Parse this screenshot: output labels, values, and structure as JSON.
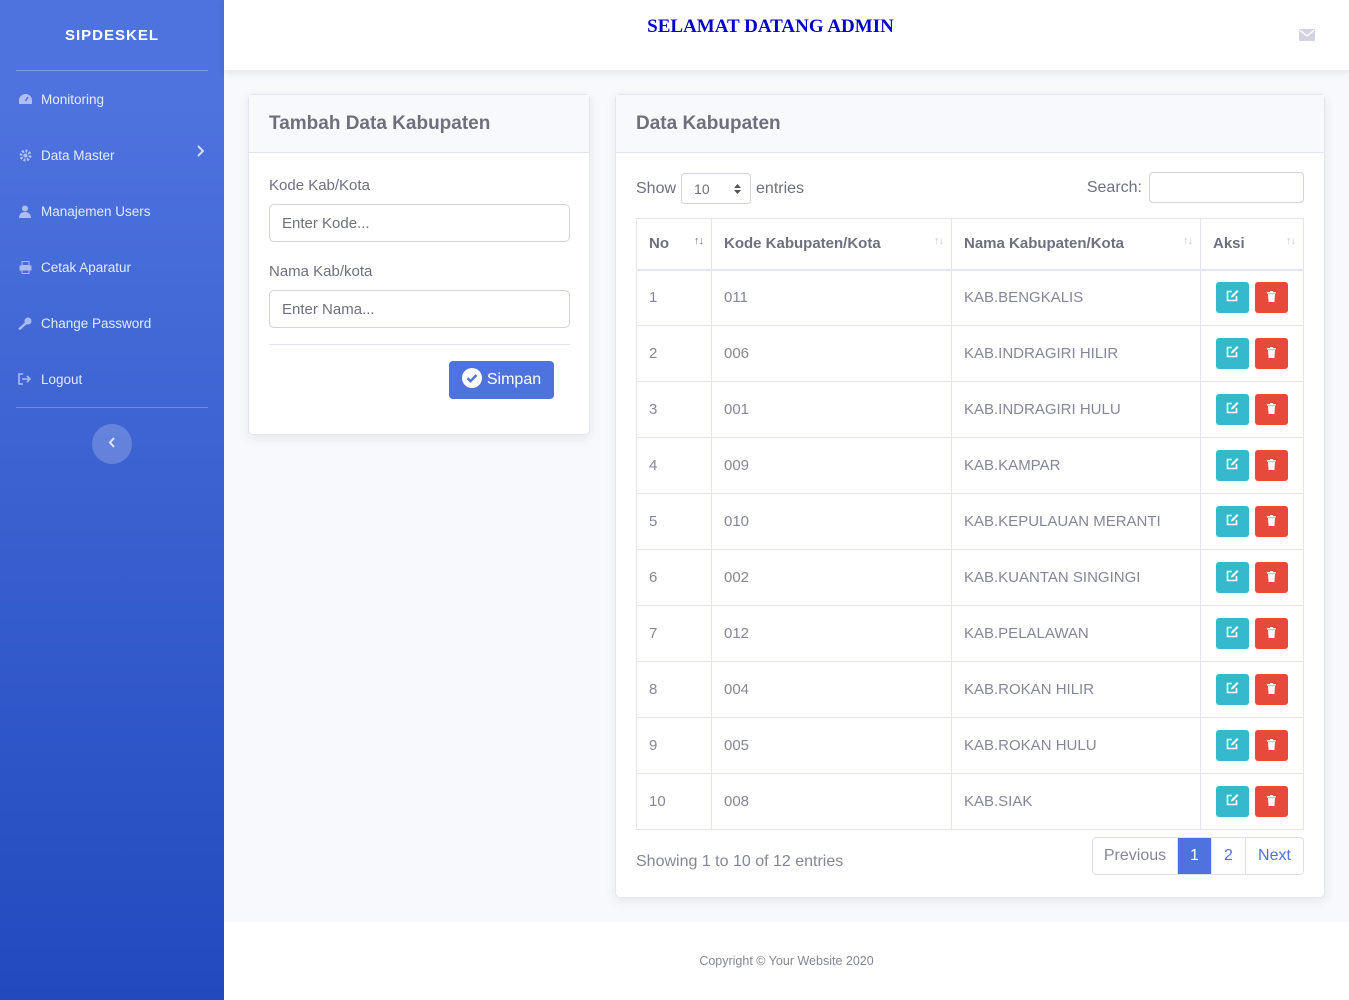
{
  "sidebar": {
    "brand": "SIPDESKEL",
    "items": [
      {
        "label": "Monitoring",
        "icon": "gauge-icon"
      },
      {
        "label": "Data Master",
        "icon": "gear-icon"
      },
      {
        "label": "Manajemen Users",
        "icon": "user-icon"
      },
      {
        "label": "Cetak Aparatur",
        "icon": "printer-icon"
      },
      {
        "label": "Change Password",
        "icon": "key-icon"
      },
      {
        "label": "Logout",
        "icon": "sign-out-icon"
      }
    ]
  },
  "topbar": {
    "welcome": "SELAMAT DATANG ADMIN"
  },
  "form": {
    "title": "Tambah Data Kabupaten",
    "kode_label": "Kode Kab/Kota",
    "kode_placeholder": "Enter Kode...",
    "nama_label": "Nama Kab/kota",
    "nama_placeholder": "Enter Nama...",
    "submit_label": "Simpan"
  },
  "table_card": {
    "title": "Data Kabupaten",
    "show_label": "Show",
    "entries_value": "10",
    "entries_label": "entries",
    "search_label": "Search:",
    "columns": [
      "No",
      "Kode Kabupaten/Kota",
      "Nama Kabupaten/Kota",
      "Aksi"
    ],
    "rows": [
      {
        "no": "1",
        "kode": "011",
        "nama": "KAB.BENGKALIS"
      },
      {
        "no": "2",
        "kode": "006",
        "nama": "KAB.INDRAGIRI HILIR"
      },
      {
        "no": "3",
        "kode": "001",
        "nama": "KAB.INDRAGIRI HULU"
      },
      {
        "no": "4",
        "kode": "009",
        "nama": "KAB.KAMPAR"
      },
      {
        "no": "5",
        "kode": "010",
        "nama": "KAB.KEPULAUAN MERANTI"
      },
      {
        "no": "6",
        "kode": "002",
        "nama": "KAB.KUANTAN SINGINGI"
      },
      {
        "no": "7",
        "kode": "012",
        "nama": "KAB.PELALAWAN"
      },
      {
        "no": "8",
        "kode": "004",
        "nama": "KAB.ROKAN HILIR"
      },
      {
        "no": "9",
        "kode": "005",
        "nama": "KAB.ROKAN HULU"
      },
      {
        "no": "10",
        "kode": "008",
        "nama": "KAB.SIAK"
      }
    ],
    "info": "Showing 1 to 10 of 12 entries",
    "pagination": {
      "previous": "Previous",
      "pages": [
        "1",
        "2"
      ],
      "active": "1",
      "next": "Next"
    }
  },
  "footer": {
    "copyright": "Copyright © Your Website 2020"
  },
  "colors": {
    "primary": "#4e73df",
    "info": "#36b9cc",
    "danger": "#e74a3b"
  }
}
